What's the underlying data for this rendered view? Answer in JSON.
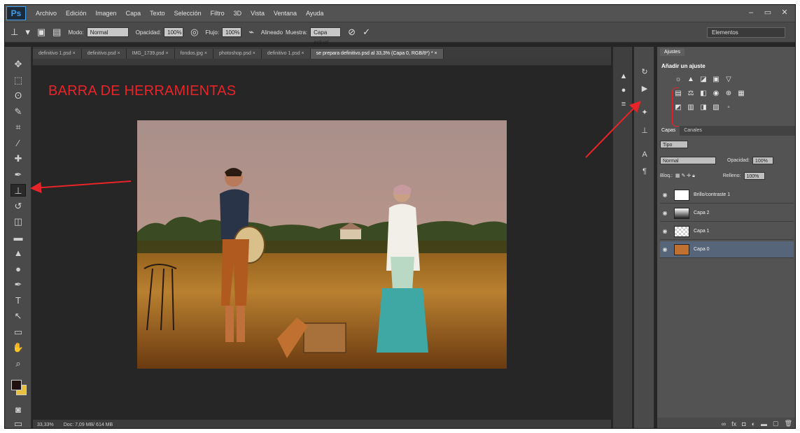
{
  "app": {
    "logo": "Ps",
    "menu": [
      "Archivo",
      "Edición",
      "Imagen",
      "Capa",
      "Texto",
      "Selección",
      "Filtro",
      "3D",
      "Vista",
      "Ventana",
      "Ayuda"
    ],
    "window_controls": [
      "–",
      "▭",
      "✕"
    ]
  },
  "options": {
    "mode_label": "Modo:",
    "mode_value": "Normal",
    "opacity_label": "Opacidad:",
    "opacity_value": "100%",
    "flow_label": "Flujo:",
    "flow_value": "100%",
    "aligned_label": "Alineado",
    "sample_label": "Muestra:",
    "sample_value": "Capa actual",
    "workspace": "Elementos"
  },
  "tabs": [
    "definitivo 1.psd ×",
    "definitivo.psd ×",
    "IMG_1739.psd ×",
    "fondos.jpg ×",
    "photoshop.psd ×",
    "definitivo 1.psd ×",
    "se prepara definitivo.psd al 33,3% (Capa 0, RGB/8*) * ×"
  ],
  "annotation": {
    "title": "BARRA DE HERRAMIENTAS",
    "color": "#e8242a"
  },
  "status": {
    "zoom": "33,33%",
    "doc": "Doc: 7,09 MB/ 614 MB"
  },
  "panels": {
    "adjust_tab": "Ajustes",
    "adjust_heading": "Añadir un ajuste",
    "layers_tab": "Capas",
    "channels_tab": "Canales",
    "kind_label": "Tipo",
    "blend_value": "Normal",
    "opacity_label": "Opacidad:",
    "opacity_value": "100%",
    "lock_label": "Bloq.:",
    "fill_label": "Relleno:",
    "fill_value": "100%",
    "layers": [
      {
        "name": "Brillo/contraste 1",
        "selected": false
      },
      {
        "name": "Capa 2",
        "selected": false
      },
      {
        "name": "Capa 1",
        "selected": false
      },
      {
        "name": "Capa 0",
        "selected": true
      }
    ]
  },
  "icons": {
    "toolbar": [
      "move-icon",
      "marquee-icon",
      "lasso-icon",
      "quick-select-icon",
      "crop-icon",
      "eyedropper-icon",
      "healing-brush-icon",
      "brush-icon",
      "clone-stamp-icon",
      "history-brush-icon",
      "eraser-icon",
      "gradient-icon",
      "blur-icon",
      "dodge-icon",
      "pen-icon",
      "type-icon",
      "path-select-icon",
      "shape-icon",
      "hand-icon",
      "zoom-icon"
    ],
    "adjustments": [
      "brightness-icon",
      "levels-icon",
      "curves-icon",
      "exposure-icon",
      "vibrance-icon",
      "hue-icon",
      "color-balance-icon",
      "bw-icon",
      "photo-filter-icon",
      "channel-mixer-icon",
      "color-lookup-icon",
      "invert-icon",
      "posterize-icon",
      "threshold-icon",
      "selective-color-icon",
      "gradient-map-icon"
    ]
  }
}
